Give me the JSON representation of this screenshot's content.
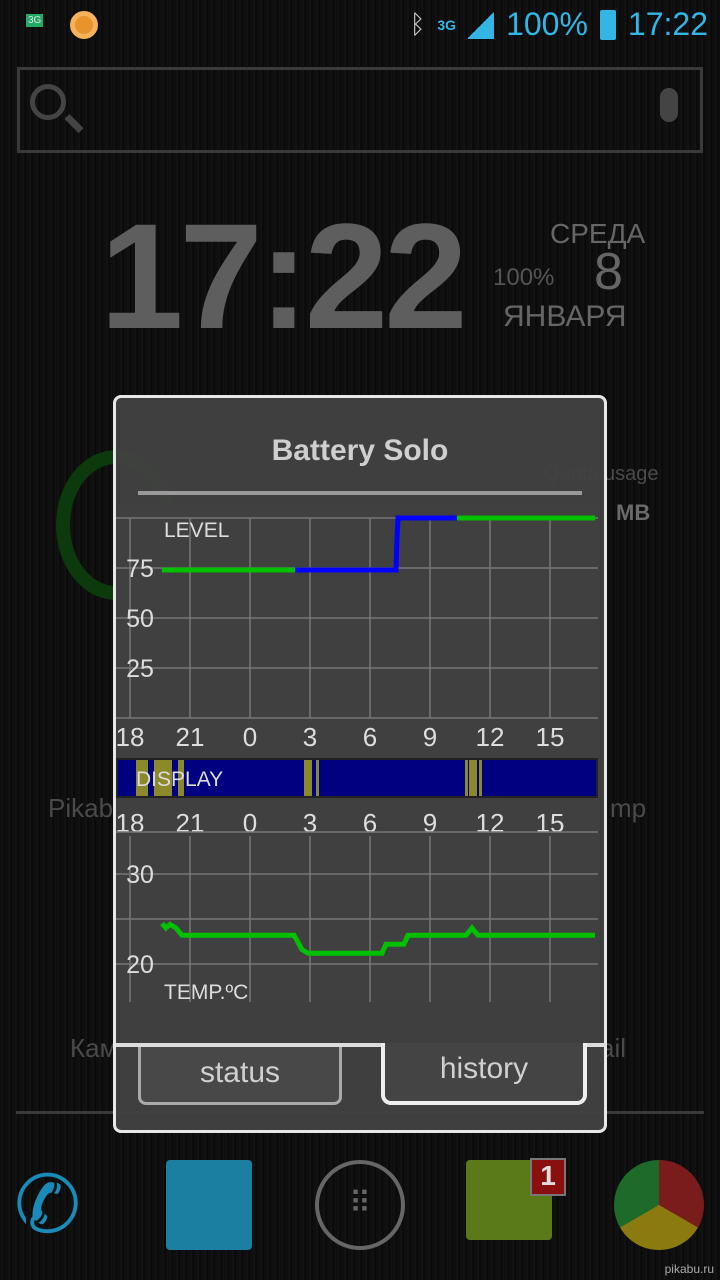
{
  "status_bar": {
    "network": "3G",
    "battery": "100%",
    "time": "17:22",
    "left_badge": "3G"
  },
  "widget_clock": {
    "time": "17:22",
    "weekday": "СРЕДА",
    "day": "8",
    "month": "ЯНВАРЯ",
    "battery": "100%"
  },
  "background": {
    "quota_label": "Quota usage",
    "quota_value": "MB",
    "app_labels": [
      "Pikab",
      "mp",
      "Кам",
      "ail"
    ]
  },
  "dialog": {
    "title": "Battery Solo",
    "tabs": [
      {
        "label": "status",
        "selected": false
      },
      {
        "label": "history",
        "selected": true
      }
    ]
  },
  "chart_data": [
    {
      "type": "line",
      "title": "LEVEL",
      "ylim": [
        0,
        100
      ],
      "yticks": [
        "75",
        "50",
        "25"
      ],
      "xticks": [
        "18",
        "21",
        "0",
        "3",
        "6",
        "9",
        "12",
        "15"
      ],
      "grid": true,
      "series": [
        {
          "color": "#00c000",
          "points": [
            [
              19.6,
              74
            ],
            [
              2.25,
              74
            ]
          ]
        },
        {
          "color": "#0000ff",
          "points": [
            [
              2.25,
              74
            ],
            [
              7.3,
              74
            ],
            [
              7.35,
              90
            ],
            [
              7.4,
              100
            ],
            [
              10.35,
              100
            ]
          ]
        },
        {
          "color": "#00c000",
          "points": [
            [
              10.35,
              100
            ],
            [
              17.25,
              100
            ]
          ]
        }
      ]
    },
    {
      "type": "timeline",
      "title": "DISPLAY",
      "xticks": [
        "18",
        "21",
        "0",
        "3",
        "6",
        "9",
        "12",
        "15"
      ],
      "off_color": "#000080",
      "on_color": "#8a8a2a",
      "on_intervals": [
        [
          18.3,
          18.9
        ],
        [
          19.2,
          20.1
        ],
        [
          20.4,
          20.7
        ],
        [
          2.7,
          3.1
        ],
        [
          3.3,
          3.45
        ],
        [
          10.75,
          10.9
        ],
        [
          10.95,
          11.35
        ],
        [
          11.45,
          11.6
        ]
      ]
    },
    {
      "type": "line",
      "title": "TEMP.ºC",
      "yticks": [
        "30",
        "20"
      ],
      "ylim": [
        19,
        31
      ],
      "grid": true,
      "series": [
        {
          "color": "#00c000",
          "points": [
            [
              19.6,
              24.5
            ],
            [
              19.8,
              24
            ],
            [
              20.0,
              24.4
            ],
            [
              20.3,
              24
            ],
            [
              20.6,
              23.2
            ],
            [
              2.2,
              23.2
            ],
            [
              2.4,
              22.4
            ],
            [
              2.6,
              21.6
            ],
            [
              2.9,
              21.2
            ],
            [
              6.6,
              21.2
            ],
            [
              6.8,
              22.2
            ],
            [
              7.7,
              22.2
            ],
            [
              7.9,
              23.2
            ],
            [
              10.8,
              23.2
            ],
            [
              11.1,
              24
            ],
            [
              11.4,
              23.2
            ],
            [
              17.25,
              23.2
            ]
          ]
        }
      ]
    }
  ],
  "dock": {
    "messages_badge": "1"
  },
  "watermark": "pikabu.ru"
}
